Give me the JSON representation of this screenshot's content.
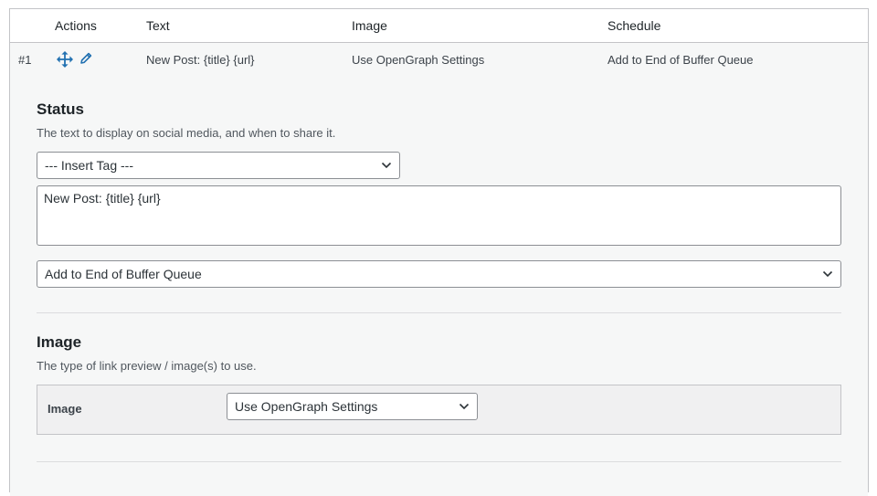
{
  "table": {
    "headers": {
      "actions": "Actions",
      "text": "Text",
      "image": "Image",
      "schedule": "Schedule"
    },
    "row": {
      "number": "#1",
      "actions": [
        "move-icon",
        "edit-icon"
      ],
      "text": "New Post: {title} {url}",
      "image": "Use OpenGraph Settings",
      "schedule": "Add to End of Buffer Queue"
    }
  },
  "status_section": {
    "title": "Status",
    "description": "The text to display on social media, and when to share it.",
    "insert_tag_select": "--- Insert Tag ---",
    "status_text": "New Post: {title} {url}",
    "schedule_select": "Add to End of Buffer Queue"
  },
  "image_section": {
    "title": "Image",
    "description": "The type of link preview / image(s) to use.",
    "field_label": "Image",
    "image_select": "Use OpenGraph Settings"
  },
  "colors": {
    "icon_blue": "#2271b1",
    "panel_bg": "#f6f7f7",
    "border": "#c3c4c7"
  }
}
